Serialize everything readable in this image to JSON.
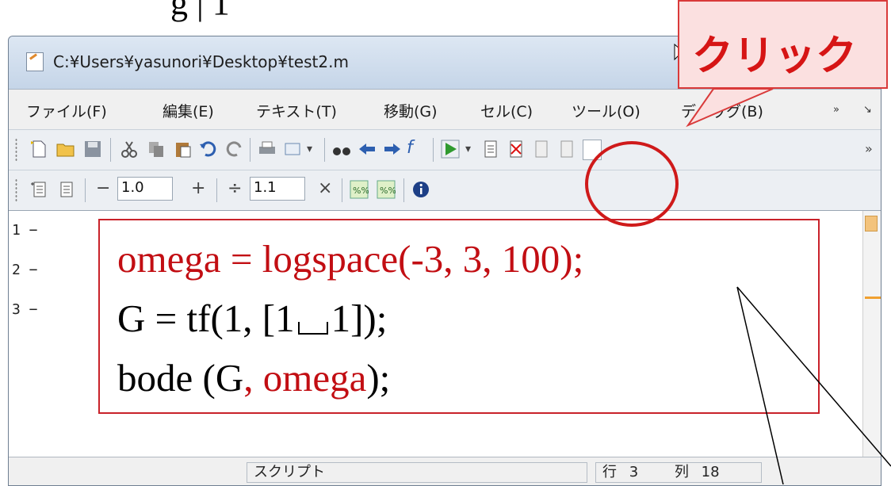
{
  "top_fragment": "g | 1",
  "window": {
    "title": "C:¥Users¥yasunori¥Desktop¥test2.m"
  },
  "menu": {
    "items": [
      "ファイル(F)",
      "編集(E)",
      "テキスト(T)",
      "移動(G)",
      "セル(C)",
      "ツール(O)",
      "デバッグ(B)"
    ],
    "overflow": "»",
    "dock": "↘"
  },
  "toolbar2": {
    "minus": "−",
    "value1": "1.0",
    "plus": "+",
    "divide": "÷",
    "value2": "1.1",
    "times": "×"
  },
  "editor": {
    "line_numbers": [
      "1 −",
      "2 −",
      "3 −"
    ],
    "code": {
      "line1": "omega = logspace(-3, 3, 100);",
      "line2_a": "G = tf(1, [1",
      "line2_b": "1]);",
      "line3_a": "bode (G",
      "line3_b": ", omega",
      "line3_c": ");"
    }
  },
  "status": {
    "mode": "スクリプト",
    "row_label": "行",
    "row_value": "3",
    "col_label": "列",
    "col_value": "18"
  },
  "annotation": {
    "callout_text": "クリック"
  },
  "colors": {
    "code_red": "#c20e13",
    "callout_border": "#d93a3a",
    "callout_fill": "#fbe0e0",
    "run_green": "#2f9a2f"
  }
}
